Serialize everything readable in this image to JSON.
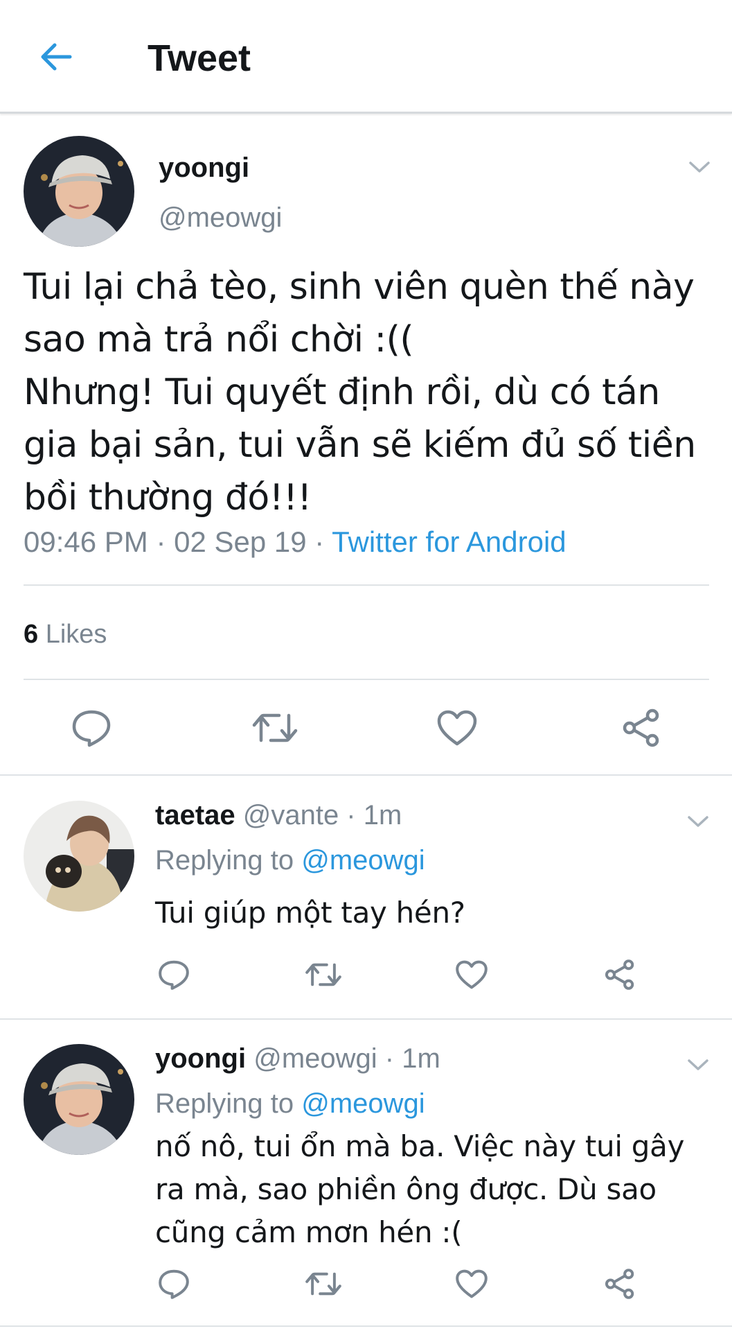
{
  "header": {
    "back_icon": "back-arrow-icon",
    "title": "Tweet"
  },
  "colors": {
    "accent": "#2b97dd",
    "secondary_text": "#7a8590",
    "divider": "#dfe3e6"
  },
  "main_tweet": {
    "name": "yoongi",
    "handle": "@meowgi",
    "text": "Tui lại chả tèo, sinh viên quèn thế này\nsao mà trả nổi chời :((\nNhưng! Tui quyết định rồi, dù có tán\ngia bại sản, tui vẫn sẽ kiếm đủ số tiền\nbồi thường đó!!!",
    "time": "09:46 PM · 02 Sep 19 · ",
    "source": "Twitter for Android",
    "likes_count": "6",
    "likes_label": " Likes"
  },
  "replies": [
    {
      "name": "taetae",
      "meta": " @vante · 1m",
      "replying_label": "Replying to ",
      "replying_to": "@meowgi",
      "text": "Tui giúp một tay hén?"
    },
    {
      "name": "yoongi",
      "meta": " @meowgi · 1m",
      "replying_label": "Replying to ",
      "replying_to": "@meowgi",
      "text": "nố nô, tui ổn mà ba. Việc này tui gây ra mà, sao phiền ông được. Dù sao cũng cảm mơn hén :("
    }
  ]
}
